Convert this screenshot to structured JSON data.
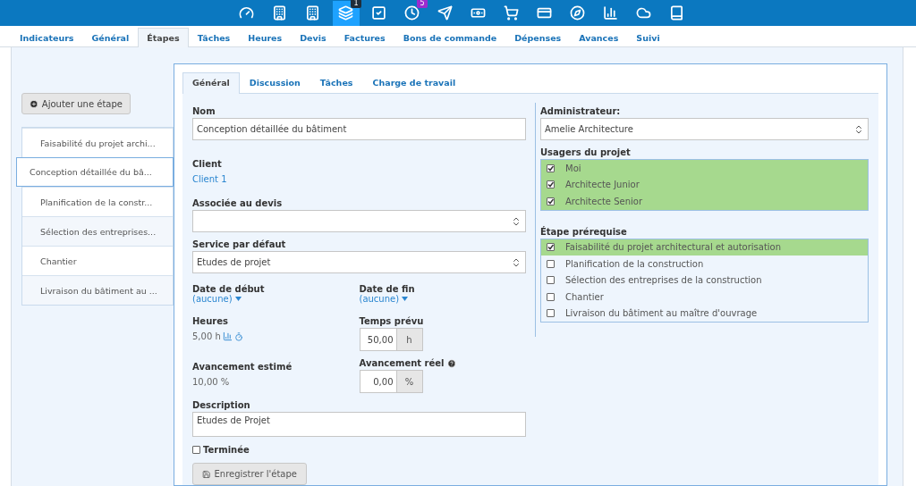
{
  "toolbar": [
    {
      "kind": "gauge",
      "selected": false
    },
    {
      "kind": "building",
      "selected": false
    },
    {
      "kind": "building",
      "selected": false
    },
    {
      "kind": "cards",
      "selected": true,
      "badge": "1",
      "color": "#1f2d3a"
    },
    {
      "kind": "check",
      "selected": false
    },
    {
      "kind": "clock",
      "selected": false,
      "badge": "5",
      "color": "#9b2ccf"
    },
    {
      "kind": "send",
      "selected": false
    },
    {
      "kind": "money",
      "selected": false
    },
    {
      "kind": "cart",
      "selected": false
    },
    {
      "kind": "card",
      "selected": false
    },
    {
      "kind": "compass",
      "selected": false
    },
    {
      "kind": "chart",
      "selected": false
    },
    {
      "kind": "cloud",
      "selected": false
    },
    {
      "kind": "book",
      "selected": false
    }
  ],
  "tabs": [
    {
      "label": "Indicateurs",
      "selected": false
    },
    {
      "label": "Général",
      "selected": false
    },
    {
      "label": "Étapes",
      "selected": true
    },
    {
      "label": "Tâches",
      "selected": false
    },
    {
      "label": "Heures",
      "selected": false
    },
    {
      "label": "Devis",
      "selected": false
    },
    {
      "label": "Factures",
      "selected": false
    },
    {
      "label": "Bons de commande",
      "selected": false
    },
    {
      "label": "Dépenses",
      "selected": false
    },
    {
      "label": "Avances",
      "selected": false
    },
    {
      "label": "Suivi",
      "selected": false
    }
  ],
  "add_button": "Ajouter une étape",
  "steps": [
    {
      "label": "Faisabilité du projet archi...",
      "selected": false
    },
    {
      "label": "Conception détaillée du bâ...",
      "selected": true
    },
    {
      "label": "Planification de la constr...",
      "selected": false
    },
    {
      "label": "Sélection des entreprises...",
      "selected": false
    },
    {
      "label": "Chantier",
      "selected": false
    },
    {
      "label": "Livraison du bâtiment au ...",
      "selected": false
    }
  ],
  "subtabs": [
    {
      "label": "Général",
      "selected": true
    },
    {
      "label": "Discussion",
      "selected": false
    },
    {
      "label": "Tâches",
      "selected": false
    },
    {
      "label": "Charge de travail",
      "selected": false
    }
  ],
  "form": {
    "nom_label": "Nom",
    "nom": "Conception détaillée du bâtiment",
    "client_label": "Client",
    "client": "Client 1",
    "devis_label": "Associée au devis",
    "service_label": "Service par défaut",
    "service": "Etudes de projet",
    "date_debut_label": "Date de début",
    "date_debut": "(aucune)",
    "date_fin_label": "Date de fin",
    "date_fin": "(aucune)",
    "heures_label": "Heures",
    "heures": "5,00 h",
    "temps_label": "Temps prévu",
    "temps": "50,00",
    "temps_unit": "h",
    "avance_est_label": "Avancement estimé",
    "avance_est": "10,00 %",
    "avance_reel_label": "Avancement réel",
    "avance_reel": "0,00",
    "avance_unit": "%",
    "description_label": "Description",
    "description": "Etudes de Projet",
    "terminee_label": "Terminée",
    "terminee": false,
    "save_button": "Enregistrer l'étape"
  },
  "admin": {
    "label": "Administrateur:",
    "value": "Amelie Architecture"
  },
  "users": {
    "label": "Usagers du projet",
    "items": [
      {
        "label": "Moi",
        "checked": true
      },
      {
        "label": "Architecte Junior",
        "checked": true
      },
      {
        "label": "Architecte Senior",
        "checked": true
      }
    ]
  },
  "prereq": {
    "label": "Étape prérequise",
    "items": [
      {
        "label": "Faisabilité du projet architectural et autorisation",
        "checked": true
      },
      {
        "label": "Planification de la construction",
        "checked": false
      },
      {
        "label": "Sélection des entreprises de la construction",
        "checked": false
      },
      {
        "label": "Chantier",
        "checked": false
      },
      {
        "label": "Livraison du bâtiment au maître d'ouvrage",
        "checked": false
      }
    ]
  }
}
